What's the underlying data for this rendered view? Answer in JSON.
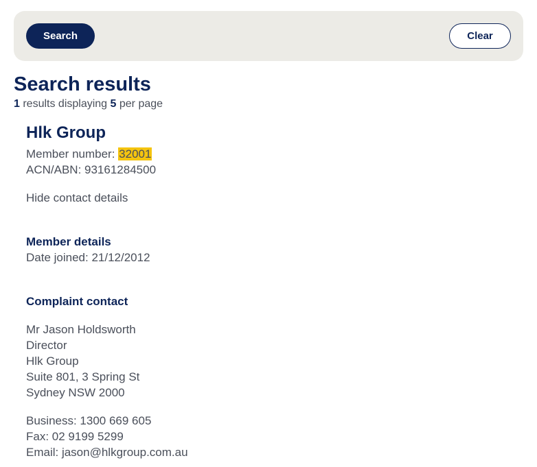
{
  "search_bar": {
    "search_label": "Search",
    "clear_label": "Clear"
  },
  "results": {
    "heading": "Search results",
    "count": "1",
    "count_suffix": " results displaying ",
    "per_page": "5",
    "per_page_suffix": " per page"
  },
  "member": {
    "name": "Hlk Group",
    "member_number_label": "Member number: ",
    "member_number": "32001",
    "acn_abn": "ACN/ABN: 93161284500",
    "toggle_contact_label": "Hide contact details",
    "details_heading": "Member details",
    "date_joined": "Date joined: 21/12/2012",
    "complaint_heading": "Complaint contact",
    "contact": {
      "name": "Mr Jason Holdsworth",
      "title": "Director",
      "company": "Hlk Group",
      "address_line1": "Suite 801, 3 Spring St",
      "address_line2": "Sydney NSW 2000",
      "business": "Business: 1300 669 605",
      "fax": "Fax: 02 9199 5299",
      "email": "Email: jason@hlkgroup.com.au"
    }
  },
  "colors": {
    "navy": "#0d2458",
    "search_panel_bg": "#ecebe6",
    "highlight": "#f5c40f",
    "body_text": "#4a4f5a"
  }
}
